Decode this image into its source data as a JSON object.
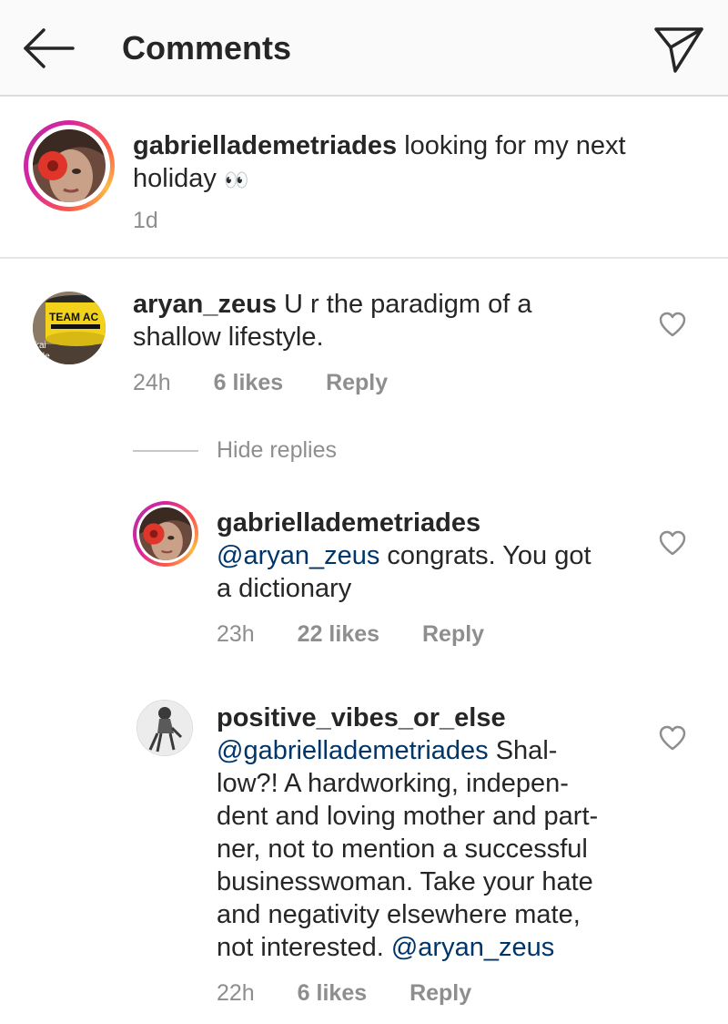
{
  "header": {
    "title": "Comments",
    "back_icon": "arrow-left-icon",
    "share_icon": "paper-plane-icon"
  },
  "caption": {
    "username": "gabriellademetriades",
    "text_line1": " looking for my next",
    "text_line2": "holiday",
    "emoji": "👀",
    "time": "1d"
  },
  "comments": [
    {
      "username": "aryan_zeus",
      "text_line1": " U r the paradigm of a",
      "text_line2": "shallow lifestyle.",
      "time": "24h",
      "likes": "6 likes",
      "reply": "Reply",
      "avatar_text": "TEAM AC",
      "avatar_small_text": "kai",
      "avatar_small_text2": "nde"
    }
  ],
  "hide_replies": "Hide replies",
  "replies": [
    {
      "username": "gabriellademetriades",
      "mention": "@aryan_zeus",
      "text_line1": " congrats. You got",
      "text_line2": "a dictionary",
      "time": "23h",
      "likes": "22 likes",
      "reply": "Reply"
    },
    {
      "username": "positive_vibes_or_else",
      "mention": "@gabriellademetriades",
      "text_line1": " Shal-",
      "lines": [
        "low?! A hardworking, indepen-",
        "dent and loving mother and part-",
        "ner, not to mention a successful",
        "businesswoman. Take your hate",
        "and negativity elsewhere mate,",
        "not interested. "
      ],
      "end_mention": "@aryan_zeus",
      "time": "22h",
      "likes": "6 likes",
      "reply": "Reply"
    }
  ],
  "colors": {
    "mention": "#003569",
    "meta": "#8e8e8e",
    "text": "#262626"
  }
}
